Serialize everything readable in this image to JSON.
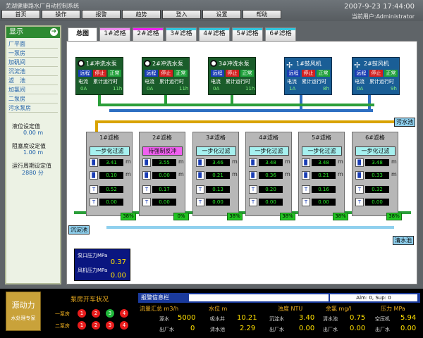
{
  "app_title": "芜湖健康路水厂自动控制系统",
  "datetime": "2007-9-23 17:44:00",
  "current_user_label": "当前用户:",
  "current_user": "Administrator",
  "menu": [
    "首页",
    "操作",
    "报警",
    "趋势",
    "登入",
    "设置",
    "帮助"
  ],
  "sidebar": {
    "title": "显示",
    "items": [
      "厂平面",
      "一泵房",
      "加矾间",
      "沉淀池",
      "滤　池",
      "加氯间",
      "二泵房",
      "污水泵房"
    ],
    "params": [
      {
        "label": "液位设定值",
        "value": "0.00 m"
      },
      {
        "label": "阻塞度设定值",
        "value": "1.00 m"
      },
      {
        "label": "运行周期设定值",
        "value": "2880 分"
      }
    ]
  },
  "tabs": [
    {
      "label": "总图",
      "stripe": ""
    },
    {
      "label": "1#滤格",
      "stripe": "#f08cf0"
    },
    {
      "label": "2#滤格",
      "stripe": "#f020f0"
    },
    {
      "label": "3#滤格",
      "stripe": "#30c8e0"
    },
    {
      "label": "4#滤格",
      "stripe": "#30c8e0"
    },
    {
      "label": "5#滤格",
      "stripe": "#30c8e0"
    },
    {
      "label": "6#滤格",
      "stripe": "#30c8e0"
    }
  ],
  "equipment": [
    {
      "name": "1#冲洗水泵",
      "type": "pump",
      "buttons": [
        "远程",
        "停止",
        "正常"
      ],
      "current_label": "电流",
      "runtime_label": "累计运行时",
      "current": "0A",
      "runtime": "11h"
    },
    {
      "name": "2#冲洗水泵",
      "type": "pump",
      "buttons": [
        "远程",
        "停止",
        "正常"
      ],
      "current_label": "电流",
      "runtime_label": "累计运行时",
      "current": "0A",
      "runtime": "11h"
    },
    {
      "name": "3#冲洗水泵",
      "type": "pump",
      "buttons": [
        "远程",
        "停止",
        "正常"
      ],
      "current_label": "电流",
      "runtime_label": "累计运行时",
      "current": "0A",
      "runtime": "11h"
    },
    {
      "name": "1#鼓风机",
      "type": "fan",
      "buttons": [
        "远程",
        "停止",
        "正常"
      ],
      "current_label": "电流",
      "runtime_label": "累计运行时",
      "current": "1A",
      "runtime": "8h"
    },
    {
      "name": "2#鼓风机",
      "type": "fan",
      "buttons": [
        "远程",
        "停止",
        "正常"
      ],
      "current_label": "电流",
      "runtime_label": "累计运行时",
      "current": "0A",
      "runtime": "9h"
    }
  ],
  "pipe_labels": {
    "sewage_top": "污水池",
    "sedimentation": "沉淀池",
    "clear_water": "清水池"
  },
  "filters": [
    {
      "name": "1#滤格",
      "status": "一步化过滤",
      "warn": false,
      "values": [
        "3.41",
        "0.10",
        "0.52",
        "0.00"
      ],
      "pct": "38%"
    },
    {
      "name": "2#滤格",
      "status": "待强制反冲",
      "warn": true,
      "values": [
        "3.55",
        "0.00",
        "0.17",
        "0.00"
      ],
      "pct": "0%"
    },
    {
      "name": "3#滤格",
      "status": "一步化过滤",
      "warn": false,
      "values": [
        "3.46",
        "0.21",
        "0.13",
        "0.00"
      ],
      "pct": "38%"
    },
    {
      "name": "4#滤格",
      "status": "一步化过滤",
      "warn": false,
      "values": [
        "3.48",
        "0.36",
        "0.20",
        "0.00"
      ],
      "pct": "38%"
    },
    {
      "name": "5#滤格",
      "status": "一步化过滤",
      "warn": false,
      "values": [
        "3.48",
        "0.21",
        "0.16",
        "0.00"
      ],
      "pct": "38%"
    },
    {
      "name": "6#滤格",
      "status": "一步化过滤",
      "warn": false,
      "values": [
        "3.48",
        "0.33",
        "0.32",
        "0.00"
      ],
      "pct": "38%"
    }
  ],
  "filter_units": [
    "m",
    "m",
    "",
    ""
  ],
  "pressure": {
    "outlet_label": "泵口压力",
    "outlet_unit": "MPa",
    "outlet_value": "0.37",
    "blower_label": "风机压力",
    "blower_unit": "MPa",
    "blower_value": "0.00"
  },
  "bottom": {
    "logo_main": "源动力",
    "logo_sub": "水处理专家",
    "status_title": "泵房开车状况",
    "rows": [
      {
        "label": "一泵房",
        "lights": [
          "1",
          "2",
          "3",
          "4"
        ],
        "colors": [
          "#e81c1c",
          "#e81c1c",
          "#1fb83a",
          "#e81c1c"
        ]
      },
      {
        "label": "二泵房",
        "lights": [
          "1",
          "2",
          "3",
          "4"
        ],
        "colors": [
          "#e81c1c",
          "#e81c1c",
          "#e81c1c",
          "#e81c1c"
        ]
      }
    ],
    "alarm_title": "报警信息栏",
    "alarm_count": "Alm: 0, Sup: 0",
    "summary": [
      {
        "head": "流量汇总 m3/h",
        "items": [
          {
            "label": "源水",
            "value": "5000"
          },
          {
            "label": "出厂水",
            "value": "0"
          }
        ]
      },
      {
        "head": "水位 m",
        "items": [
          {
            "label": "吸水井",
            "value": "10.21"
          },
          {
            "label": "清水池",
            "value": "2.29"
          }
        ]
      },
      {
        "head": "浊度 NTU",
        "items": [
          {
            "label": "沉淀水",
            "value": "3.40"
          },
          {
            "label": "出厂水",
            "value": "0.00"
          }
        ]
      },
      {
        "head": "余氯 mg/l",
        "items": [
          {
            "label": "清水池",
            "value": "0.75"
          },
          {
            "label": "出厂水",
            "value": "0.00"
          }
        ]
      },
      {
        "head": "压力 MPa",
        "items": [
          {
            "label": "空压机",
            "value": "5.94"
          },
          {
            "label": "出厂水",
            "value": "0.00"
          }
        ]
      }
    ]
  }
}
